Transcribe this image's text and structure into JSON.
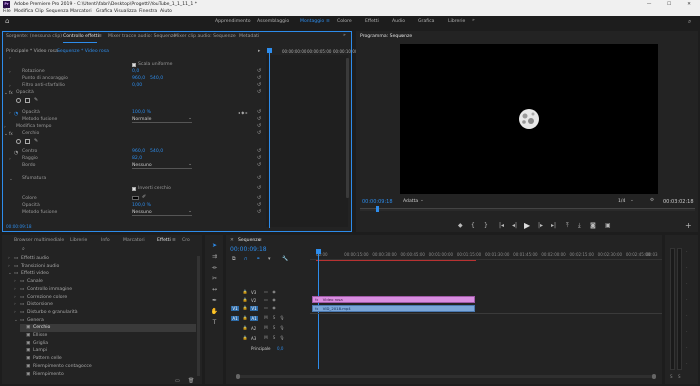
{
  "titlebar": {
    "title": "Adobe Premiere Pro 2019 - C:\\Utenti\\fabri\\Desktop\\Progetti\\YouTube_1_1_11_1 *"
  },
  "menu": [
    "File",
    "Modifica",
    "Clip",
    "Sequenza",
    "Marcatori",
    "Grafica",
    "Visualizza",
    "Finestra",
    "Aiuto"
  ],
  "workspaces": [
    "Apprendimento",
    "Assemblaggio",
    "Montaggio",
    "Colore",
    "Effetti",
    "Audio",
    "Grafica",
    "Librerie"
  ],
  "workspace_active": "Montaggio",
  "top_tabs": [
    "Sorgente: (nessuna clip)",
    "Controllo effetti",
    "Mixer tracce audio: Sequenze",
    "Mixer clip audio: Sequenze",
    "Metadati"
  ],
  "effect_controls": {
    "header_left": "Principale * Video rosa",
    "header_right": "Sequenze * Video rosa",
    "ruler_times": [
      "00:00:00:00",
      "00:00:05:00",
      "00:00:10:00"
    ],
    "rows": {
      "scale_uniform": "Scala uniforme",
      "rotation_label": "Rotazione",
      "rotation_val": "0,0",
      "anchor_label": "Punto di ancoraggio",
      "anchor_x": "960,0",
      "anchor_y": "540,0",
      "flicker_label": "Filtro anti-sfarfallio",
      "flicker_val": "0,00",
      "opacity_label": "Opacità",
      "opacity_row_label": "Opacità",
      "opacity_val": "100,0 %",
      "blend_label": "Metodo fusione",
      "blend_val": "Normale",
      "time_remap": "Modifica tempo",
      "circle_label": "Cerchio",
      "center_label": "Centro",
      "center_x": "960,0",
      "center_y": "540,0",
      "radius_label": "Raggio",
      "radius_val": "82,0",
      "edge_label": "Bordo",
      "edge_val": "Nessuno",
      "feather_label": "Sfumatura",
      "invert_label": "Inverti cerchio",
      "color_label": "Colore",
      "opacity2_label": "Opacità",
      "opacity2_val": "100,0 %",
      "blend2_label": "Metodo fusione",
      "blend2_val": "Nessuno"
    },
    "timecode": "00:00:09:18"
  },
  "program_monitor": {
    "tab": "Programma: Sequenze",
    "timecode_left": "00:00:09:18",
    "fit": "Adatta",
    "quality": "1/4",
    "timecode_right": "00:03:02:18"
  },
  "project_tabs": [
    "Browser multimediale",
    "Librerie",
    "Info",
    "Marcatori",
    "Effetti",
    "Cro"
  ],
  "project_active": "Effetti",
  "effects_tree": [
    {
      "label": "Effetti audio",
      "level": 0,
      "icon": "folder"
    },
    {
      "label": "Transizioni audio",
      "level": 0,
      "icon": "folder"
    },
    {
      "label": "Effetti video",
      "level": 0,
      "icon": "folder",
      "open": true
    },
    {
      "label": "Canale",
      "level": 1,
      "icon": "folder"
    },
    {
      "label": "Controllo immagine",
      "level": 1,
      "icon": "folder"
    },
    {
      "label": "Correzione colore",
      "level": 1,
      "icon": "folder"
    },
    {
      "label": "Distorsione",
      "level": 1,
      "icon": "folder"
    },
    {
      "label": "Disturbo e granularità",
      "level": 1,
      "icon": "folder"
    },
    {
      "label": "Genera",
      "level": 1,
      "icon": "folder",
      "open": true
    },
    {
      "label": "Cerchio",
      "level": 2,
      "icon": "fx",
      "selected": true
    },
    {
      "label": "Ellisse",
      "level": 2,
      "icon": "fx"
    },
    {
      "label": "Griglia",
      "level": 2,
      "icon": "fx"
    },
    {
      "label": "Lampi",
      "level": 2,
      "icon": "fx"
    },
    {
      "label": "Pattern celle",
      "level": 2,
      "icon": "fx"
    },
    {
      "label": "Riempimento contagocce",
      "level": 2,
      "icon": "fx"
    },
    {
      "label": "Riempimento",
      "level": 2,
      "icon": "fx"
    }
  ],
  "timeline": {
    "tab": "Sequenze",
    "timecode": "00:00:09:18",
    "ruler": [
      "00:00",
      "00:00:15:00",
      "00:00:30:00",
      "00:00:45:00",
      "00:01:00:00",
      "00:01:15:00",
      "00:01:30:00",
      "00:01:45:00",
      "00:02:00:00",
      "00:02:15:00",
      "00:02:30:00",
      "00:02:45:00",
      "00:03"
    ],
    "video_tracks": [
      "V3",
      "V2",
      "V1"
    ],
    "audio_tracks": [
      "A1",
      "A2",
      "A3"
    ],
    "source_v": "V1",
    "source_a": "A1",
    "master_label": "Principale",
    "master_val": "0,0",
    "clip_v": "Video rosa",
    "clip_a": "VID_2018.mp4"
  },
  "colors": {
    "accent": "#2d8ceb",
    "clip_video": "#d98ee0",
    "clip_audio": "#7ba6d8",
    "panel": "#232323",
    "background": "#1d1d1d",
    "monitor_bg": "#000000"
  }
}
